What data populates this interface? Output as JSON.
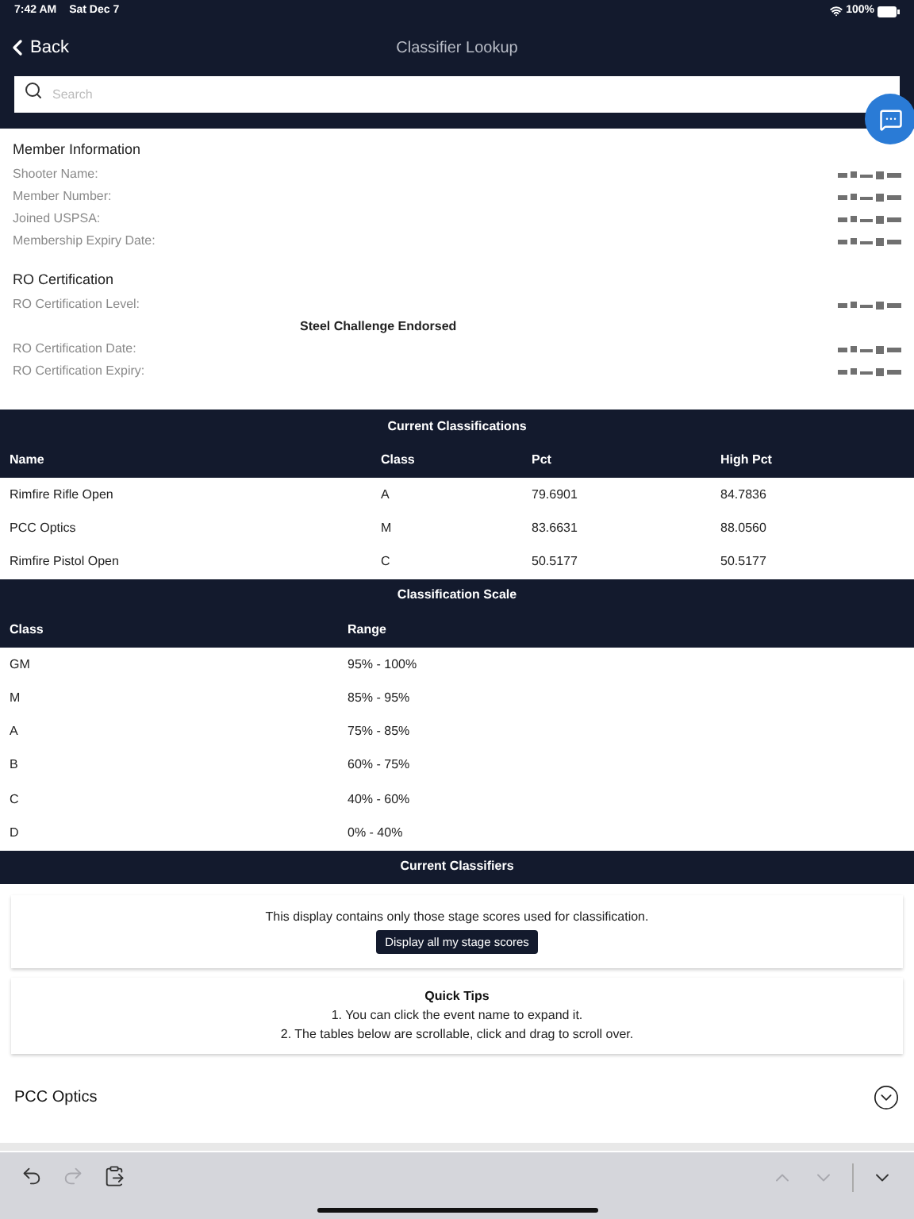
{
  "status_bar": {
    "time": "7:42 AM",
    "date": "Sat Dec 7",
    "battery": "100%"
  },
  "nav": {
    "back": "Back",
    "title": "Classifier Lookup"
  },
  "search": {
    "placeholder": "Search"
  },
  "member_information": {
    "title": "Member Information",
    "fields": [
      {
        "label": "Shooter Name:"
      },
      {
        "label": "Member Number:"
      },
      {
        "label": "Joined USPSA:"
      },
      {
        "label": "Membership Expiry Date:"
      }
    ]
  },
  "ro_certification": {
    "title": "RO Certification",
    "fields": [
      {
        "kind": "field",
        "label": "RO Certification Level:"
      },
      {
        "kind": "note",
        "text": "Steel Challenge Endorsed"
      },
      {
        "kind": "field",
        "label": "RO Certification Date:"
      },
      {
        "kind": "field",
        "label": "RO Certification Expiry:"
      }
    ]
  },
  "current_classifications": {
    "title": "Current Classifications",
    "columns": [
      "Name",
      "Class",
      "Pct",
      "High Pct"
    ],
    "rows": [
      [
        "Rimfire Rifle Open",
        "A",
        "79.6901",
        "84.7836"
      ],
      [
        "PCC Optics",
        "M",
        "83.6631",
        "88.0560"
      ],
      [
        "Rimfire Pistol Open",
        "C",
        "50.5177",
        "50.5177"
      ]
    ]
  },
  "classification_scale": {
    "title": "Classification Scale",
    "columns": [
      "Class",
      "Range"
    ],
    "rows": [
      [
        "GM",
        "95% - 100%"
      ],
      [
        "M",
        "85% - 95%"
      ],
      [
        "A",
        "75% - 85%"
      ],
      [
        "B",
        "60% - 75%"
      ],
      [
        "C",
        "40% - 60%"
      ],
      [
        "D",
        "0% - 40%"
      ]
    ]
  },
  "current_classifiers": {
    "title": "Current Classifiers",
    "notice": "This display contains only those stage scores used for classification.",
    "button": "Display all my stage scores",
    "tips_title": "Quick Tips",
    "tips": [
      "1. You can click the event name to expand it.",
      "2. The tables below are scrollable, click and drag to scroll over."
    ],
    "events": [
      {
        "name": "PCC Optics",
        "expanded": false
      }
    ]
  },
  "keyboard_toolbar": [
    {
      "kind": "undo",
      "disabled": false
    },
    {
      "kind": "redo",
      "disabled": true
    },
    {
      "kind": "paste",
      "disabled": false
    },
    {
      "kind": "up",
      "disabled": true
    },
    {
      "kind": "down",
      "disabled": true
    },
    {
      "kind": "dismiss",
      "disabled": false
    }
  ]
}
